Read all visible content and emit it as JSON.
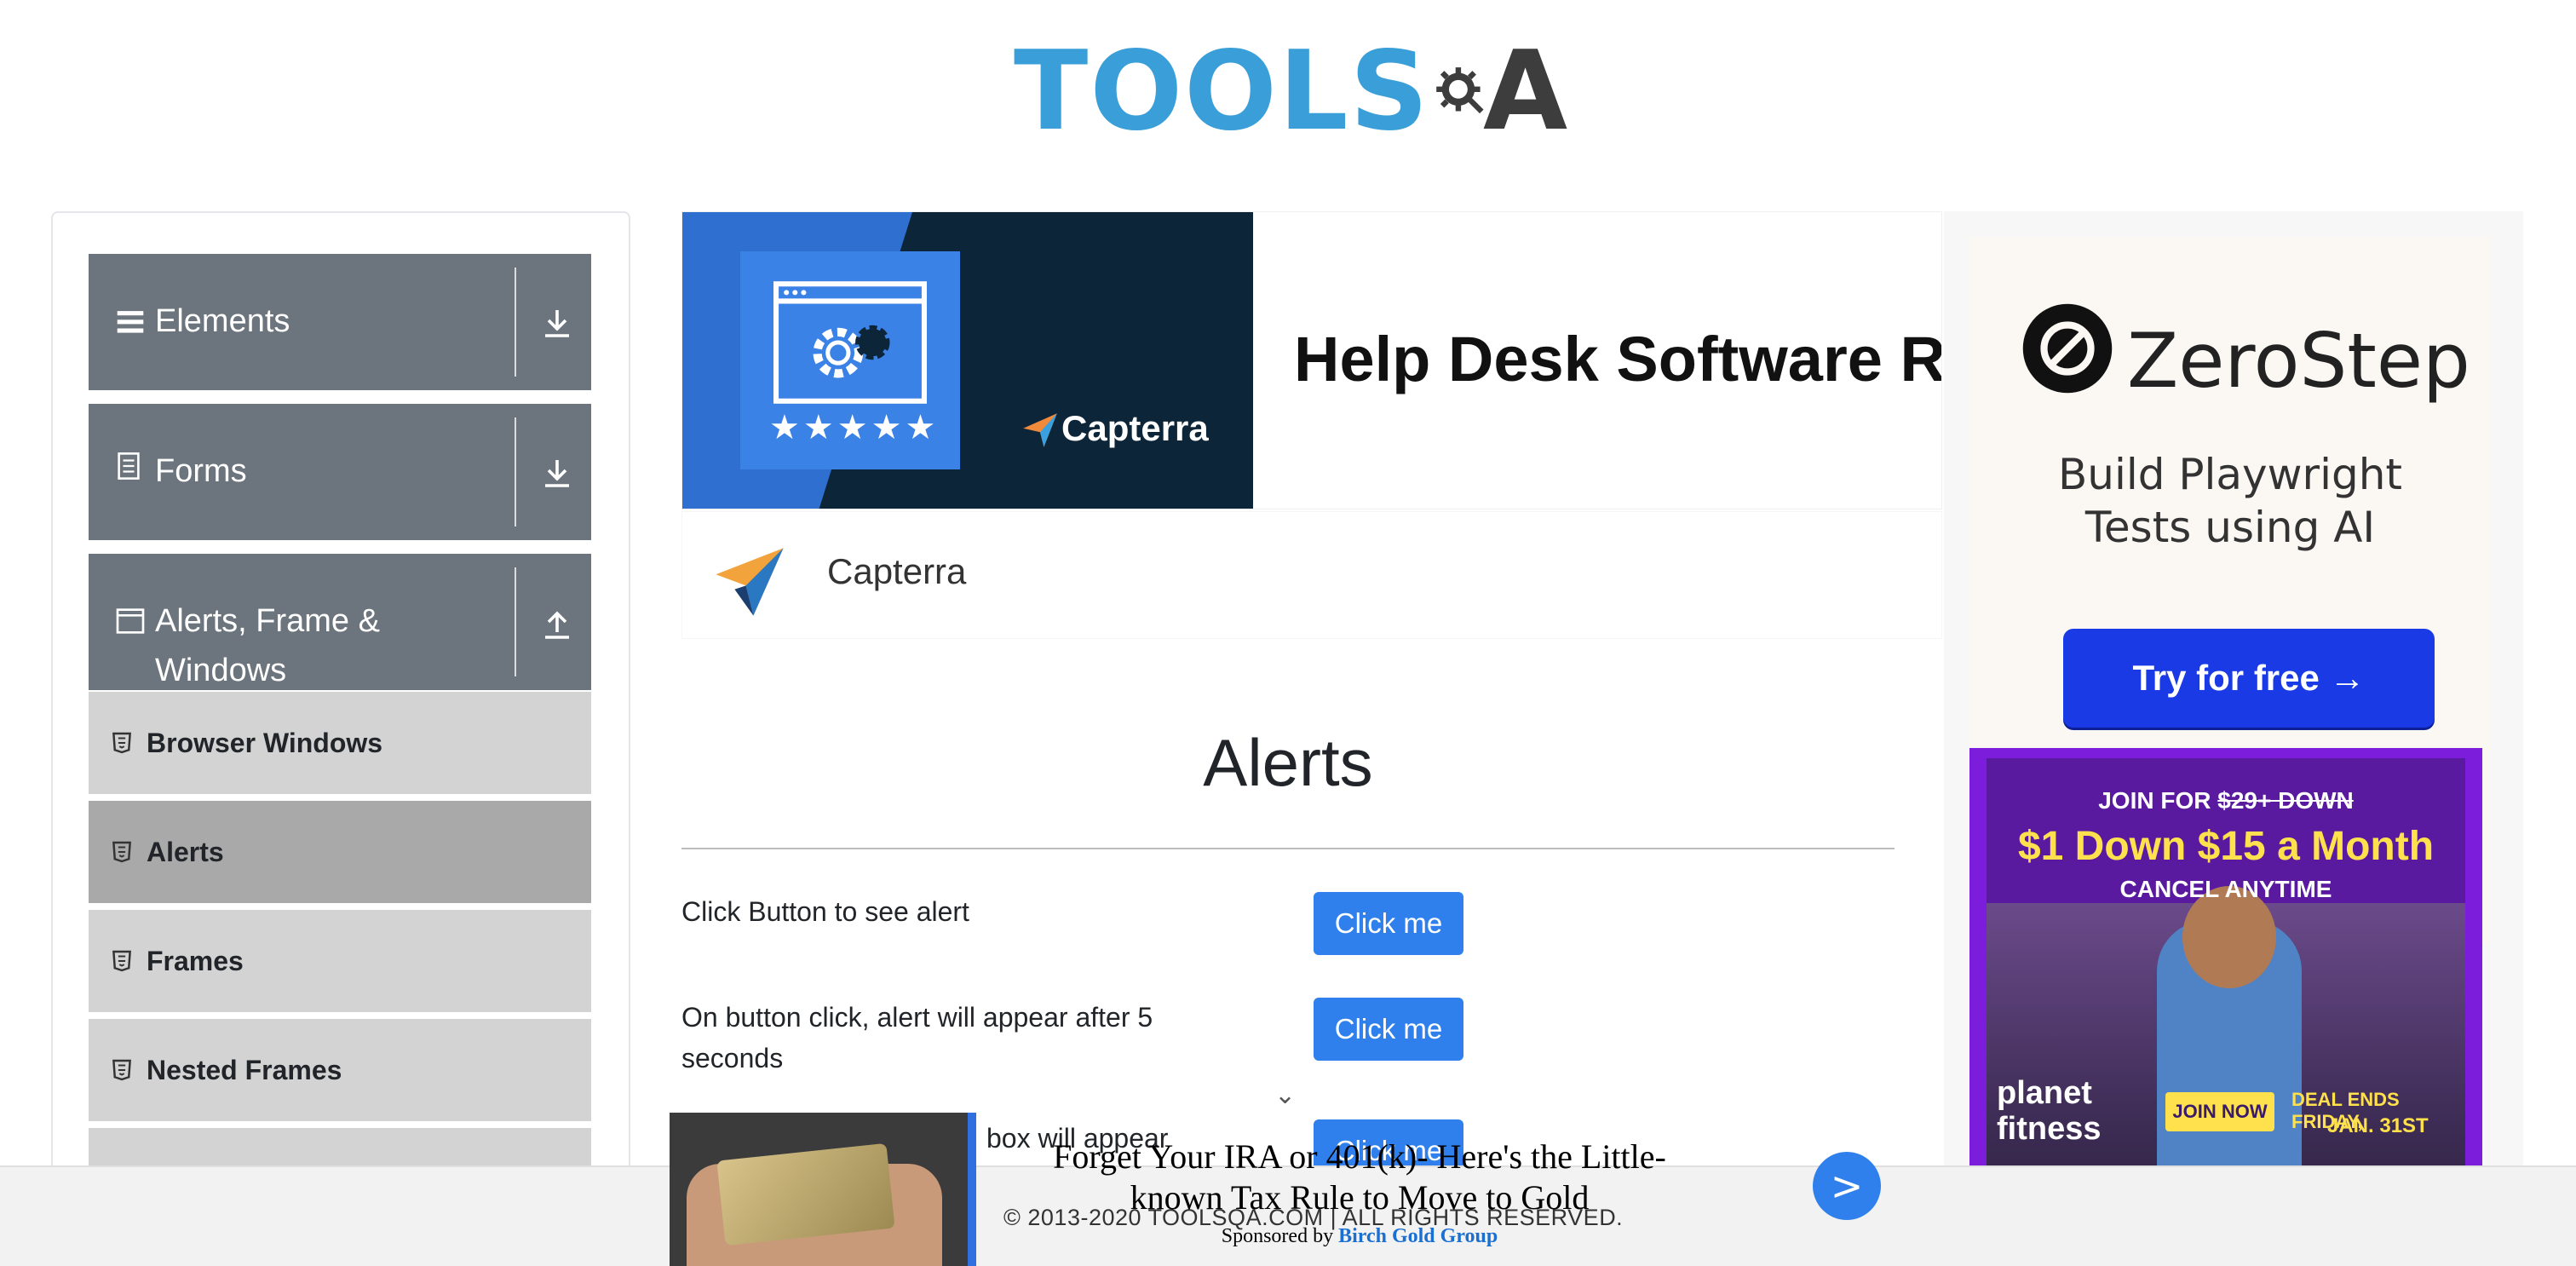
{
  "header": {
    "logo_text_left": "TOOLS",
    "logo_text_right": "A",
    "logo_accent": "#3a9fd8",
    "logo_dark": "#3d3d3d"
  },
  "sidebar": {
    "groups": [
      {
        "title": "Elements",
        "icon": "hamburger-icon",
        "arrow": "download-arrow-icon"
      },
      {
        "title": "Forms",
        "icon": "document-icon",
        "arrow": "download-arrow-icon"
      },
      {
        "title_line1": "Alerts, Frame &",
        "title_line2": "Windows",
        "icon": "window-icon",
        "arrow": "upload-arrow-icon"
      }
    ],
    "items": [
      {
        "label": "Browser Windows",
        "active": false
      },
      {
        "label": "Alerts",
        "active": true
      },
      {
        "label": "Frames",
        "active": false
      },
      {
        "label": "Nested Frames",
        "active": false
      }
    ],
    "header_color": "#6c757d",
    "item_color": "#d3d3d3",
    "active_color": "#a9a9a9"
  },
  "banner_ad": {
    "headline": "Help Desk Software Rev",
    "capterra_logo_text": "Capterra",
    "stars": "★★★★★",
    "brand_label": "Capterra"
  },
  "main": {
    "title": "Alerts",
    "rows": [
      {
        "label": "Click Button to see alert",
        "button": "Click me"
      },
      {
        "label": "On button click, alert will appear after 5 seconds",
        "button": "Click me"
      },
      {
        "label": "box will appear",
        "button": "Click me"
      }
    ],
    "button_color": "#2f80ed"
  },
  "right_ad": {
    "zerostep_name": "ZeroStep",
    "tagline_line1": "Build Playwright",
    "tagline_line2": "Tests using AI",
    "cta": "Try for free →",
    "pf_join": "JOIN FOR",
    "pf_old_price": "$29+ DOWN",
    "pf_deal": "$1 Down $15 a Month",
    "pf_cancel": "CANCEL ANYTIME",
    "pf_brand_line1": "planet",
    "pf_brand_line2": "fitness",
    "pf_join_now": "JOIN NOW",
    "pf_deal_ends_line1": "DEAL ENDS FRIDAY,",
    "pf_deal_ends_line2": "JAN. 31ST"
  },
  "footer": {
    "copyright": "© 2013-2020 TOOLSQA.COM | ALL RIGHTS RESERVED."
  },
  "sticky_ad": {
    "headline": "Forget Your IRA or 401(k)- Here's the Little-known Tax Rule to Move to Gold",
    "sponsored_prefix": "Sponsored by",
    "sponsor": "Birch Gold Group",
    "go_label": ">"
  }
}
